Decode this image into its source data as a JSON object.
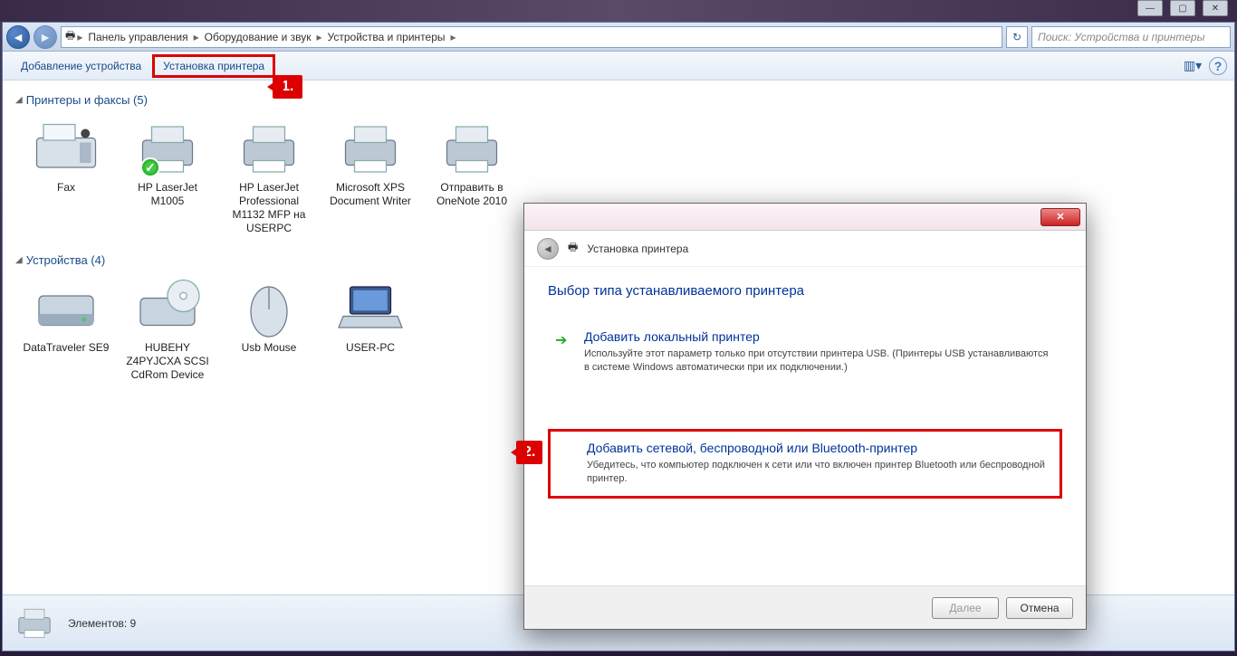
{
  "window_controls": {
    "min": "—",
    "max": "▢",
    "close": "✕"
  },
  "breadcrumbs": [
    "Панель управления",
    "Оборудование и звук",
    "Устройства и принтеры"
  ],
  "nav": {
    "refresh_icon": "↻",
    "search_placeholder": "Поиск: Устройства и принтеры"
  },
  "toolbar": {
    "add_device": "Добавление устройства",
    "add_printer": "Установка принтера",
    "view_icon": "▥▾",
    "help_icon": "?"
  },
  "callouts": {
    "one": "1.",
    "two": "2."
  },
  "groups": [
    {
      "title": "Принтеры и факсы (5)",
      "items": [
        {
          "label": "Fax",
          "icon": "fax",
          "default": false
        },
        {
          "label": "HP LaserJet M1005",
          "icon": "printer",
          "default": true
        },
        {
          "label": "HP LaserJet Professional M1132 MFP на USERPC",
          "icon": "printer",
          "default": false
        },
        {
          "label": "Microsoft XPS Document Writer",
          "icon": "printer",
          "default": false
        },
        {
          "label": "Отправить в OneNote 2010",
          "icon": "printer",
          "default": false
        }
      ]
    },
    {
      "title": "Устройства (4)",
      "items": [
        {
          "label": "DataTraveler SE9",
          "icon": "drive",
          "default": false
        },
        {
          "label": "HUBEHY Z4PYJCXA SCSI CdRom Device",
          "icon": "cd",
          "default": false
        },
        {
          "label": "Usb Mouse",
          "icon": "mouse",
          "default": false
        },
        {
          "label": "USER-PC",
          "icon": "laptop",
          "default": false
        }
      ]
    }
  ],
  "status": {
    "text": "Элементов: 9"
  },
  "dialog": {
    "crumb_title": "Установка принтера",
    "heading": "Выбор типа устанавливаемого принтера",
    "options": [
      {
        "title": "Добавить локальный принтер",
        "desc": "Используйте этот параметр только при отсутствии принтера USB. (Принтеры USB устанавливаются в системе Windows автоматически при их подключении.)"
      },
      {
        "title": "Добавить сетевой, беспроводной или Bluetooth-принтер",
        "desc": "Убедитесь, что компьютер подключен к сети или что включен принтер Bluetooth или беспроводной принтер."
      }
    ],
    "buttons": {
      "next": "Далее",
      "cancel": "Отмена",
      "close": "✕"
    }
  }
}
